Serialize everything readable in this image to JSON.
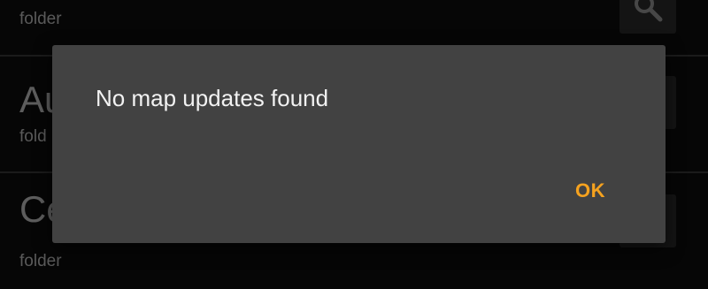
{
  "list": {
    "items": [
      {
        "title": "",
        "subtitle": "folder",
        "action_icon": "search-icon"
      },
      {
        "title": "Au",
        "subtitle": "fold",
        "action_icon": "search-icon"
      },
      {
        "title": "Ce",
        "subtitle": "folder",
        "action_icon": "search-icon"
      }
    ]
  },
  "dialog": {
    "message": "No map updates found",
    "ok_label": "OK",
    "accent_color": "#f5a21f",
    "background_color": "#424242"
  }
}
